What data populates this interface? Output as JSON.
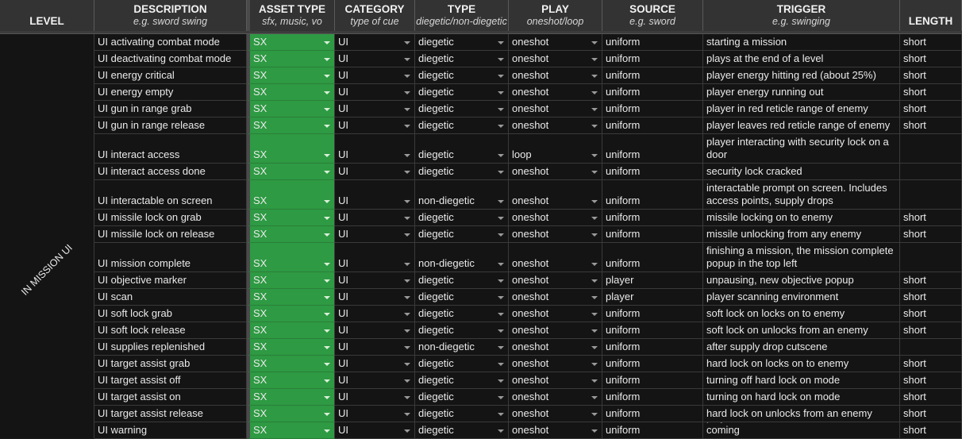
{
  "headers": {
    "level": {
      "title": "LEVEL"
    },
    "description": {
      "title": "DESCRIPTION",
      "hint": "e.g. sword swing"
    },
    "asset_type": {
      "title": "ASSET TYPE",
      "hint": "sfx, music, vo"
    },
    "category": {
      "title": "CATEGORY",
      "hint": "type of cue"
    },
    "type": {
      "title": "TYPE",
      "hint": "diegetic/non-diegetic"
    },
    "play": {
      "title": "PLAY",
      "hint": "oneshot/loop"
    },
    "source": {
      "title": "SOURCE",
      "hint": "e.g. sword"
    },
    "trigger": {
      "title": "TRIGGER",
      "hint": "e.g. swinging"
    },
    "length": {
      "title": "LENGTH"
    }
  },
  "level_group": "IN MISSION UI",
  "colors": {
    "asset_type_fill": "#2e9a43",
    "header_bg": "#333333",
    "cell_bg": "#141414"
  },
  "icons": {
    "dropdown": "chevron-down-icon"
  },
  "rows": [
    {
      "description": "UI activating combat mode",
      "asset_type": "SX",
      "category": "UI",
      "type": "diegetic",
      "play": "oneshot",
      "source": "uniform",
      "trigger": "starting a mission",
      "length": "short"
    },
    {
      "description": "UI deactivating combat mode",
      "asset_type": "SX",
      "category": "UI",
      "type": "diegetic",
      "play": "oneshot",
      "source": "uniform",
      "trigger": "plays at the end of a level",
      "length": "short"
    },
    {
      "description": "UI energy critical",
      "asset_type": "SX",
      "category": "UI",
      "type": "diegetic",
      "play": "oneshot",
      "source": "uniform",
      "trigger": "player energy hitting red (about 25%)",
      "length": "short"
    },
    {
      "description": "UI energy empty",
      "asset_type": "SX",
      "category": "UI",
      "type": "diegetic",
      "play": "oneshot",
      "source": "uniform",
      "trigger": "player energy running out",
      "length": "short"
    },
    {
      "description": "UI gun in range grab",
      "asset_type": "SX",
      "category": "UI",
      "type": "diegetic",
      "play": "oneshot",
      "source": "uniform",
      "trigger": "player in red reticle range of enemy",
      "length": "short"
    },
    {
      "description": "UI gun in range release",
      "asset_type": "SX",
      "category": "UI",
      "type": "diegetic",
      "play": "oneshot",
      "source": "uniform",
      "trigger": "player leaves red reticle range of enemy",
      "length": "short"
    },
    {
      "description": "UI interact access",
      "asset_type": "SX",
      "category": "UI",
      "type": "diegetic",
      "play": "loop",
      "source": "uniform",
      "trigger": "player interacting with security lock on a door",
      "length": ""
    },
    {
      "description": "UI interact access done",
      "asset_type": "SX",
      "category": "UI",
      "type": "diegetic",
      "play": "oneshot",
      "source": "uniform",
      "trigger": "security lock cracked",
      "length": ""
    },
    {
      "description": "UI interactable on screen",
      "asset_type": "SX",
      "category": "UI",
      "type": "non-diegetic",
      "play": "oneshot",
      "source": "uniform",
      "trigger": "interactable prompt on screen. Includes access points, supply drops",
      "length": ""
    },
    {
      "description": "UI missile lock on grab",
      "asset_type": "SX",
      "category": "UI",
      "type": "diegetic",
      "play": "oneshot",
      "source": "uniform",
      "trigger": "missile locking on to enemy",
      "length": "short"
    },
    {
      "description": "UI missile lock on release",
      "asset_type": "SX",
      "category": "UI",
      "type": "diegetic",
      "play": "oneshot",
      "source": "uniform",
      "trigger": "missile unlocking from any enemy",
      "length": "short"
    },
    {
      "description": "UI mission complete",
      "asset_type": "SX",
      "category": "UI",
      "type": "non-diegetic",
      "play": "oneshot",
      "source": "uniform",
      "trigger": "finishing a mission, the mission complete popup in the top left",
      "length": ""
    },
    {
      "description": "UI objective marker",
      "asset_type": "SX",
      "category": "UI",
      "type": "diegetic",
      "play": "oneshot",
      "source": "player",
      "trigger": "unpausing, new objective popup",
      "length": "short"
    },
    {
      "description": "UI scan",
      "asset_type": "SX",
      "category": "UI",
      "type": "diegetic",
      "play": "oneshot",
      "source": "player",
      "trigger": "player scanning environment",
      "length": "short"
    },
    {
      "description": "UI soft lock grab",
      "asset_type": "SX",
      "category": "UI",
      "type": "diegetic",
      "play": "oneshot",
      "source": "uniform",
      "trigger": "soft lock on locks on to enemy",
      "length": "short"
    },
    {
      "description": "UI soft lock release",
      "asset_type": "SX",
      "category": "UI",
      "type": "diegetic",
      "play": "oneshot",
      "source": "uniform",
      "trigger": "soft lock on unlocks from an enemy",
      "length": "short"
    },
    {
      "description": "UI supplies replenished",
      "asset_type": "SX",
      "category": "UI",
      "type": "non-diegetic",
      "play": "oneshot",
      "source": "uniform",
      "trigger": "after supply drop cutscene",
      "length": ""
    },
    {
      "description": "UI target assist grab",
      "asset_type": "SX",
      "category": "UI",
      "type": "diegetic",
      "play": "oneshot",
      "source": "uniform",
      "trigger": "hard lock on locks on to enemy",
      "length": "short"
    },
    {
      "description": "UI target assist off",
      "asset_type": "SX",
      "category": "UI",
      "type": "diegetic",
      "play": "oneshot",
      "source": "uniform",
      "trigger": "turning off hard lock on mode",
      "length": "short"
    },
    {
      "description": "UI target assist on",
      "asset_type": "SX",
      "category": "UI",
      "type": "diegetic",
      "play": "oneshot",
      "source": "uniform",
      "trigger": "turning on hard lock on mode",
      "length": "short"
    },
    {
      "description": "UI target assist release",
      "asset_type": "SX",
      "category": "UI",
      "type": "diegetic",
      "play": "oneshot",
      "source": "uniform",
      "trigger": "hard lock on unlocks from an enemy",
      "length": "short"
    },
    {
      "description": "UI warning",
      "asset_type": "SX",
      "category": "UI",
      "type": "diegetic",
      "play": "oneshot",
      "source": "uniform",
      "trigger": "player is locked on to and a shot is coming",
      "length": "short"
    }
  ]
}
